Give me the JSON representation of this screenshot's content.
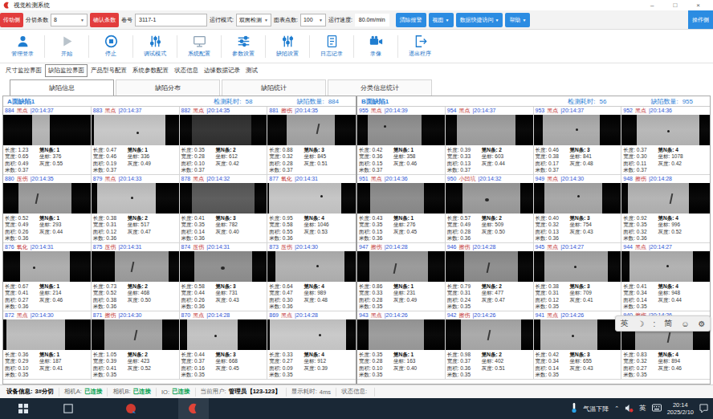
{
  "window": {
    "title": "视觉检测系统",
    "minimize": "–",
    "maximize": "□",
    "close": "×"
  },
  "toolbar": {
    "side_button": "传动侧",
    "split_label": "分切条数",
    "split_value": "8",
    "confirm_button": "确认条数",
    "roll_label": "卷号",
    "roll_value": "3117-1",
    "mode_label": "运行模式:",
    "mode_value": "双面检测",
    "points_label": "图表点数:",
    "points_value": "100",
    "speed_label": "运行速度:",
    "speed_value": "80.0m/min",
    "clear_alarm_button": "清除报警",
    "view_button": "视图",
    "data_access_button": "数据快捷访问",
    "help_button": "帮助",
    "operate_side_button": "操作侧"
  },
  "actions": [
    {
      "key": "login",
      "icon": "user-icon",
      "label": "管理登录"
    },
    {
      "key": "start",
      "icon": "play-icon",
      "label": "开始"
    },
    {
      "key": "stop",
      "icon": "stop-icon",
      "label": "停止"
    },
    {
      "key": "debug",
      "icon": "debug-sliders-icon",
      "label": "调试模式"
    },
    {
      "key": "sysconf",
      "icon": "monitor-icon",
      "label": "系统配置"
    },
    {
      "key": "params",
      "icon": "hsliders-icon",
      "label": "参数设置"
    },
    {
      "key": "defectset",
      "icon": "vsliders-icon",
      "label": "缺陷设置"
    },
    {
      "key": "log",
      "icon": "log-icon",
      "label": "日志记录"
    },
    {
      "key": "record",
      "icon": "camera-icon",
      "label": "录像"
    },
    {
      "key": "exit",
      "icon": "exit-icon",
      "label": "退出程序"
    }
  ],
  "main_tabs": [
    "尺寸监控界面",
    "缺陷监控界面",
    "产品型号配置",
    "系统参数配置",
    "状态信息",
    "边缘数据记录",
    "测试"
  ],
  "main_tabs_active": 1,
  "sub_tabs": [
    "缺陷信息",
    "缺陷分布",
    "缺陷统计",
    "分类信息统计"
  ],
  "sub_tabs_active": 0,
  "cell_labels": {
    "len": "长度:",
    "wid": "宽度:",
    "area": "面积:",
    "m": "米数:",
    "n": "第N条:",
    "coord": "坐标:",
    "gray": "灰度:"
  },
  "panels": [
    {
      "title": "A面缺陷1",
      "time_label": "检测耗时:",
      "time": "58",
      "count_label": "缺陷数量:",
      "count": "884",
      "cells": [
        {
          "id": "884",
          "type": "黑点",
          "time": "20:14:37",
          "len": "1.23",
          "wid": "0.65",
          "area": "0.49",
          "m": "0.37",
          "n": "1",
          "coord": "376",
          "gray": "0.55",
          "img": {
            "l": 33,
            "r": 47,
            "c": "#b4b4b4",
            "mark": "none",
            "mx": 50,
            "my": 50
          }
        },
        {
          "id": "883",
          "type": "黑点",
          "time": "20:14:37",
          "len": "0.47",
          "wid": "0.46",
          "area": "0.19",
          "m": "0.37",
          "n": "1",
          "coord": "336",
          "gray": "0.49",
          "img": {
            "l": 3,
            "r": 16,
            "c": "#c6c6c6",
            "mark": "dot",
            "mx": 52,
            "my": 55
          }
        },
        {
          "id": "882",
          "type": "黑点",
          "time": "20:14:35",
          "len": "0.35",
          "wid": "0.28",
          "area": "0.10",
          "m": "0.37",
          "n": "2",
          "coord": "612",
          "gray": "0.42",
          "img": {
            "l": 14,
            "r": 18,
            "c": "#303030",
            "mark": "none",
            "mx": 50,
            "my": 50
          }
        },
        {
          "id": "881",
          "type": "擦伤",
          "time": "20:14:35",
          "len": "0.88",
          "wid": "0.32",
          "area": "0.28",
          "m": "0.37",
          "n": "3",
          "coord": "845",
          "gray": "0.51",
          "img": {
            "l": 22,
            "r": 24,
            "c": "#a2a2a2",
            "mark": "scratch",
            "mx": 56,
            "my": 30
          }
        },
        {
          "id": "880",
          "type": "压伤",
          "time": "20:14:35",
          "len": "0.52",
          "wid": "0.49",
          "area": "0.26",
          "m": "0.36",
          "n": "1",
          "coord": "293",
          "gray": "0.44",
          "img": {
            "l": 17,
            "r": 22,
            "c": "#9a9a9a",
            "mark": "scratch",
            "mx": 38,
            "my": 35
          }
        },
        {
          "id": "879",
          "type": "黑点",
          "time": "20:14:33",
          "len": "0.38",
          "wid": "0.31",
          "area": "0.12",
          "m": "0.36",
          "n": "2",
          "coord": "517",
          "gray": "0.47",
          "img": {
            "l": 6,
            "r": 27,
            "c": "#c0c0c0",
            "mark": "dot",
            "mx": 45,
            "my": 45
          }
        },
        {
          "id": "878",
          "type": "黑点",
          "time": "20:14:32",
          "len": "0.41",
          "wid": "0.35",
          "area": "0.14",
          "m": "0.36",
          "n": "3",
          "coord": "782",
          "gray": "0.40",
          "img": {
            "l": 14,
            "r": 14,
            "c": "#585858",
            "mark": "none",
            "mx": 50,
            "my": 50
          }
        },
        {
          "id": "877",
          "type": "氧化",
          "time": "20:14:31",
          "len": "0.95",
          "wid": "0.58",
          "area": "0.55",
          "m": "0.36",
          "n": "4",
          "coord": "1046",
          "gray": "0.53",
          "img": {
            "l": 2,
            "r": 16,
            "c": "#c4c4c4",
            "mark": "dot",
            "mx": 60,
            "my": 40
          }
        },
        {
          "id": "876",
          "type": "氧化",
          "time": "20:14:31",
          "len": "0.67",
          "wid": "0.41",
          "area": "0.27",
          "m": "0.36",
          "n": "1",
          "coord": "214",
          "gray": "0.46",
          "img": {
            "l": 19,
            "r": 24,
            "c": "#acacac",
            "mark": "dot",
            "mx": 34,
            "my": 50
          }
        },
        {
          "id": "875",
          "type": "压伤",
          "time": "20:14:31",
          "len": "0.73",
          "wid": "0.52",
          "area": "0.38",
          "m": "0.36",
          "n": "2",
          "coord": "468",
          "gray": "0.50",
          "img": {
            "l": 27,
            "r": 12,
            "c": "#9c9c9c",
            "mark": "scratch",
            "mx": 46,
            "my": 35
          }
        },
        {
          "id": "874",
          "type": "压伤",
          "time": "20:14:31",
          "len": "0.58",
          "wid": "0.44",
          "area": "0.26",
          "m": "0.36",
          "n": "3",
          "coord": "731",
          "gray": "0.43",
          "img": {
            "l": 17,
            "r": 17,
            "c": "#8e8e8e",
            "mark": "blob",
            "mx": 47,
            "my": 50
          }
        },
        {
          "id": "873",
          "type": "压伤",
          "time": "20:14:30",
          "len": "0.64",
          "wid": "0.47",
          "area": "0.30",
          "m": "0.36",
          "n": "4",
          "coord": "989",
          "gray": "0.48",
          "img": {
            "l": 9,
            "r": 13,
            "c": "#b0b0b0",
            "mark": "dot",
            "mx": 55,
            "my": 45
          }
        },
        {
          "id": "872",
          "type": "黑点",
          "time": "20:14:30",
          "len": "0.36",
          "wid": "0.29",
          "area": "0.10",
          "m": "0.35",
          "n": "1",
          "coord": "187",
          "gray": "0.41",
          "img": {
            "l": 4,
            "r": 29,
            "c": "#bcbcbc",
            "mark": "none",
            "mx": 50,
            "my": 50
          }
        },
        {
          "id": "871",
          "type": "擦伤",
          "time": "20:14:30",
          "len": "1.05",
          "wid": "0.39",
          "area": "0.41",
          "m": "0.35",
          "n": "2",
          "coord": "423",
          "gray": "0.52",
          "img": {
            "l": 15,
            "r": 19,
            "c": "#a0a0a0",
            "mark": "scratch",
            "mx": 50,
            "my": 35
          }
        },
        {
          "id": "870",
          "type": "黑点",
          "time": "20:14:28",
          "len": "0.44",
          "wid": "0.37",
          "area": "0.16",
          "m": "0.35",
          "n": "3",
          "coord": "668",
          "gray": "0.45",
          "img": {
            "l": 8,
            "r": 33,
            "c": "#c2c2c2",
            "mark": "dot",
            "mx": 40,
            "my": 50
          }
        },
        {
          "id": "869",
          "type": "黑点",
          "time": "20:14:28",
          "len": "0.33",
          "wid": "0.27",
          "area": "0.09",
          "m": "0.35",
          "n": "4",
          "coord": "912",
          "gray": "0.39",
          "img": {
            "l": 3,
            "r": 11,
            "c": "#c8c8c8",
            "mark": "dot",
            "mx": 58,
            "my": 48
          }
        }
      ]
    },
    {
      "title": "B面缺陷1",
      "time_label": "检测耗时:",
      "time": "56",
      "count_label": "缺陷数量:",
      "count": "955",
      "cells": [
        {
          "id": "955",
          "type": "黑点",
          "time": "20:14:39",
          "len": "0.42",
          "wid": "0.36",
          "area": "0.15",
          "m": "0.37",
          "n": "1",
          "coord": "358",
          "gray": "0.46",
          "img": {
            "l": 12,
            "r": 27,
            "c": "#8e8e8e",
            "mark": "dot",
            "mx": 30,
            "my": 35
          }
        },
        {
          "id": "954",
          "type": "黑点",
          "time": "20:14:37",
          "len": "0.39",
          "wid": "0.33",
          "area": "0.13",
          "m": "0.37",
          "n": "2",
          "coord": "603",
          "gray": "0.44",
          "img": {
            "l": 13,
            "r": 20,
            "c": "#9e9e9e",
            "mark": "none",
            "mx": 50,
            "my": 50
          }
        },
        {
          "id": "953",
          "type": "黑点",
          "time": "20:14:37",
          "len": "0.46",
          "wid": "0.38",
          "area": "0.17",
          "m": "0.37",
          "n": "3",
          "coord": "841",
          "gray": "0.48",
          "img": {
            "l": 10,
            "r": 24,
            "c": "#aaaaaa",
            "mark": "dot",
            "mx": 48,
            "my": 45
          }
        },
        {
          "id": "952",
          "type": "黑点",
          "time": "20:14:36",
          "len": "0.37",
          "wid": "0.30",
          "area": "0.11",
          "m": "0.37",
          "n": "4",
          "coord": "1078",
          "gray": "0.42",
          "img": {
            "l": 17,
            "r": 12,
            "c": "#b6b6b6",
            "mark": "dot",
            "mx": 52,
            "my": 50
          }
        },
        {
          "id": "951",
          "type": "黑点",
          "time": "20:14:36",
          "len": "0.43",
          "wid": "0.35",
          "area": "0.15",
          "m": "0.36",
          "n": "1",
          "coord": "276",
          "gray": "0.45",
          "img": {
            "l": 15,
            "r": 24,
            "c": "#8a8a8a",
            "mark": "none",
            "mx": 50,
            "my": 50
          }
        },
        {
          "id": "950",
          "type": "小凹坑",
          "time": "20:14:32",
          "len": "0.57",
          "wid": "0.49",
          "area": "0.28",
          "m": "0.36",
          "n": "2",
          "coord": "509",
          "gray": "0.50",
          "img": {
            "l": 19,
            "r": 15,
            "c": "#9a9a9a",
            "mark": "blob",
            "mx": 45,
            "my": 50
          }
        },
        {
          "id": "949",
          "type": "黑点",
          "time": "20:14:30",
          "len": "0.40",
          "wid": "0.32",
          "area": "0.13",
          "m": "0.36",
          "n": "3",
          "coord": "754",
          "gray": "0.43",
          "img": {
            "l": 12,
            "r": 21,
            "c": "#a6a6a6",
            "mark": "dot",
            "mx": 50,
            "my": 40
          }
        },
        {
          "id": "948",
          "type": "擦伤",
          "time": "20:14:28",
          "len": "0.92",
          "wid": "0.35",
          "area": "0.32",
          "m": "0.36",
          "n": "4",
          "coord": "996",
          "gray": "0.52",
          "img": {
            "l": 7,
            "r": 24,
            "c": "#b2b2b2",
            "mark": "scratch",
            "mx": 55,
            "my": 35
          }
        },
        {
          "id": "947",
          "type": "擦伤",
          "time": "20:14:28",
          "len": "0.86",
          "wid": "0.33",
          "area": "0.28",
          "m": "0.35",
          "n": "1",
          "coord": "231",
          "gray": "0.49",
          "img": {
            "l": 14,
            "r": 19,
            "c": "#989898",
            "mark": "scratch",
            "mx": 42,
            "my": 40
          }
        },
        {
          "id": "946",
          "type": "擦伤",
          "time": "20:14:28",
          "len": "0.79",
          "wid": "0.31",
          "area": "0.24",
          "m": "0.35",
          "n": "2",
          "coord": "477",
          "gray": "0.47",
          "img": {
            "l": 21,
            "r": 17,
            "c": "#8c8c8c",
            "mark": "scratch",
            "mx": 48,
            "my": 38
          }
        },
        {
          "id": "945",
          "type": "黑点",
          "time": "20:14:27",
          "len": "0.38",
          "wid": "0.31",
          "area": "0.12",
          "m": "0.35",
          "n": "3",
          "coord": "709",
          "gray": "0.41",
          "img": {
            "l": 12,
            "r": 15,
            "c": "#a4a4a4",
            "mark": "dot",
            "mx": 46,
            "my": 48
          }
        },
        {
          "id": "944",
          "type": "黑点",
          "time": "20:14:27",
          "len": "0.41",
          "wid": "0.34",
          "area": "0.14",
          "m": "0.35",
          "n": "4",
          "coord": "948",
          "gray": "0.44",
          "img": {
            "l": 9,
            "r": 19,
            "c": "#b0b0b0",
            "mark": "dot",
            "mx": 51,
            "my": 44
          }
        },
        {
          "id": "943",
          "type": "黑点",
          "time": "20:14:26",
          "len": "0.35",
          "wid": "0.28",
          "area": "0.10",
          "m": "0.35",
          "n": "1",
          "coord": "163",
          "gray": "0.40",
          "img": {
            "l": 13,
            "r": 24,
            "c": "#9a9a9a",
            "mark": "none",
            "mx": 50,
            "my": 50
          }
        },
        {
          "id": "942",
          "type": "擦伤",
          "time": "20:14:26",
          "len": "0.98",
          "wid": "0.37",
          "area": "0.36",
          "m": "0.35",
          "n": "2",
          "coord": "402",
          "gray": "0.51",
          "img": {
            "l": 17,
            "r": 14,
            "c": "#a8a8a8",
            "mark": "scratch",
            "mx": 49,
            "my": 35
          }
        },
        {
          "id": "941",
          "type": "黑点",
          "time": "20:14:26",
          "len": "0.42",
          "wid": "0.34",
          "area": "0.14",
          "m": "0.35",
          "n": "3",
          "coord": "655",
          "gray": "0.43",
          "img": {
            "l": 7,
            "r": 27,
            "c": "#b4b4b4",
            "mark": "dot",
            "mx": 44,
            "my": 50
          }
        },
        {
          "id": "940",
          "type": "擦伤",
          "time": "20:14:26",
          "len": "0.83",
          "wid": "0.32",
          "area": "0.27",
          "m": "0.35",
          "n": "4",
          "coord": "894",
          "gray": "0.46",
          "img": {
            "l": 15,
            "r": 19,
            "c": "#a0a0a0",
            "mark": "scratch",
            "mx": 53,
            "my": 42
          }
        }
      ]
    }
  ],
  "statusbar": [
    {
      "label": "设备信息:",
      "value": "3#分切",
      "style": "strong"
    },
    {
      "label": "相机A:",
      "value": "已连接",
      "style": "green"
    },
    {
      "label": "相机B:",
      "value": "已连接",
      "style": "green"
    },
    {
      "label": "IO:",
      "value": "已连接",
      "style": "green"
    },
    {
      "label": "当前用户:",
      "value": "管理员【123-123】",
      "style": "strong"
    },
    {
      "label": "显示耗时:",
      "value": "4ms",
      "style": "plain"
    },
    {
      "label": "状态信息:",
      "value": "",
      "style": "plain"
    }
  ],
  "taskbar": {
    "weather": "气温下降",
    "lang": "英",
    "time": "20:14",
    "date": "2025/2/10"
  },
  "langbar": {
    "items": [
      "英",
      "☽",
      ":",
      "简",
      "☺",
      "⚙"
    ]
  }
}
